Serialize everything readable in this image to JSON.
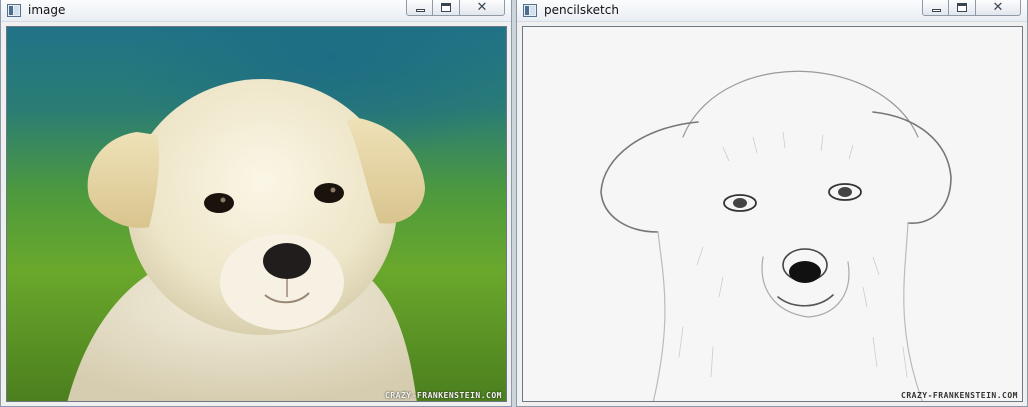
{
  "left_window": {
    "title": "image",
    "close_glyph": "✕",
    "watermark": "CRAZY-FRANKENSTEIN.COM"
  },
  "right_window": {
    "title": "pencilsketch",
    "close_glyph": "✕",
    "watermark": "CRAZY-FRANKENSTEIN.COM"
  }
}
